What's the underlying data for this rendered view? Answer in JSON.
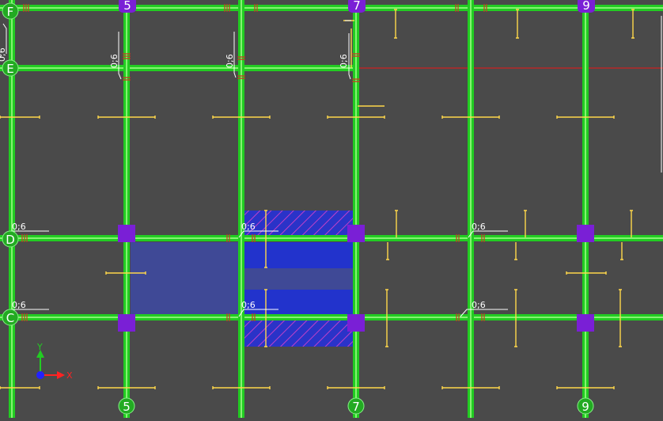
{
  "view": {
    "background": "#4a4a4a",
    "beam_color": "#22cc22",
    "beam_core": "#a6ff8c",
    "column_color": "#7a1fd6",
    "slab_fill": "#2233cc",
    "hatch_color": "#cc44cc",
    "rebar_color": "#ffd84a",
    "rebar_marks": "#cc3322",
    "axis_line": "#cc2222"
  },
  "grid": {
    "vertical": [
      {
        "label": "5"
      },
      {
        "label": "7"
      },
      {
        "label": "9"
      }
    ],
    "horizontal": [
      {
        "label": "F"
      },
      {
        "label": "E"
      },
      {
        "label": "D"
      },
      {
        "label": "C"
      }
    ]
  },
  "dims": {
    "text": "0;6"
  },
  "ucs": {
    "x_label": "X",
    "y_label": "Y",
    "x_color": "#ff2222",
    "y_color": "#22cc22",
    "origin_color": "#2222ff"
  }
}
